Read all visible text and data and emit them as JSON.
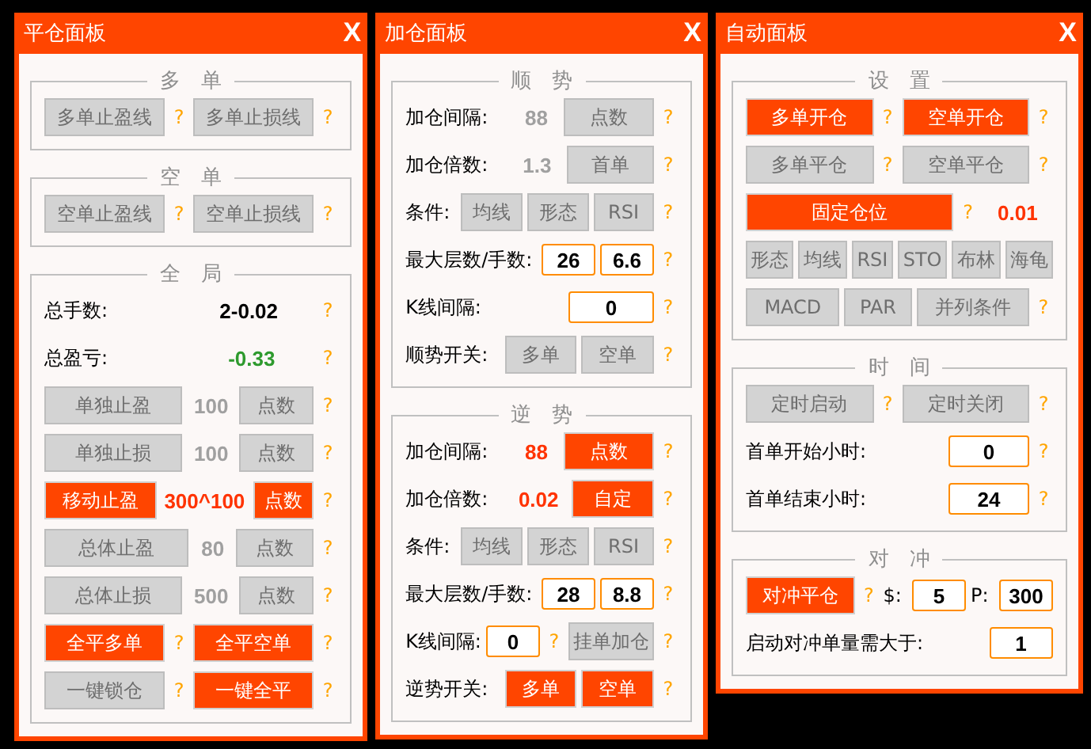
{
  "panels": [
    {
      "title": "平仓面板",
      "close": "X",
      "groups": [
        {
          "legend": "多　单",
          "rows": [
            {
              "items": [
                {
                  "kind": "button",
                  "label": "多单止盈线",
                  "on": false
                },
                {
                  "kind": "help",
                  "text": "?"
                },
                {
                  "kind": "button",
                  "label": "多单止损线",
                  "on": false
                },
                {
                  "kind": "help",
                  "text": "?"
                }
              ]
            }
          ]
        },
        {
          "legend": "空　单",
          "rows": [
            {
              "items": [
                {
                  "kind": "button",
                  "label": "空单止盈线",
                  "on": false
                },
                {
                  "kind": "help",
                  "text": "?"
                },
                {
                  "kind": "button",
                  "label": "空单止损线",
                  "on": false
                },
                {
                  "kind": "help",
                  "text": "?"
                }
              ]
            }
          ]
        },
        {
          "legend": "全　局",
          "rows": [
            {
              "items": [
                {
                  "kind": "label",
                  "text": "总手数:"
                },
                {
                  "kind": "value",
                  "text": "2-0.02",
                  "color": "#000000"
                },
                {
                  "kind": "help",
                  "text": "?"
                }
              ]
            },
            {
              "items": [
                {
                  "kind": "label",
                  "text": "总盈亏:"
                },
                {
                  "kind": "value",
                  "text": "-0.33",
                  "color": "#2e9a2e"
                },
                {
                  "kind": "help",
                  "text": "?"
                }
              ]
            },
            {
              "items": [
                {
                  "kind": "button",
                  "label": "单独止盈",
                  "on": false
                },
                {
                  "kind": "value",
                  "text": "100",
                  "color": "#a0a0a0"
                },
                {
                  "kind": "button",
                  "label": "点数",
                  "on": false
                },
                {
                  "kind": "help",
                  "text": "?"
                }
              ]
            },
            {
              "items": [
                {
                  "kind": "button",
                  "label": "单独止损",
                  "on": false
                },
                {
                  "kind": "value",
                  "text": "100",
                  "color": "#a0a0a0"
                },
                {
                  "kind": "button",
                  "label": "点数",
                  "on": false
                },
                {
                  "kind": "help",
                  "text": "?"
                }
              ]
            },
            {
              "items": [
                {
                  "kind": "button",
                  "label": "移动止盈",
                  "on": true
                },
                {
                  "kind": "value",
                  "text": "300^100",
                  "color": "#ff3300"
                },
                {
                  "kind": "button",
                  "label": "点数",
                  "on": true
                },
                {
                  "kind": "help",
                  "text": "?"
                }
              ]
            },
            {
              "items": [
                {
                  "kind": "button",
                  "label": "总体止盈",
                  "on": false
                },
                {
                  "kind": "value",
                  "text": "80",
                  "color": "#a0a0a0"
                },
                {
                  "kind": "button",
                  "label": "点数",
                  "on": false
                },
                {
                  "kind": "help",
                  "text": "?"
                }
              ]
            },
            {
              "items": [
                {
                  "kind": "button",
                  "label": "总体止损",
                  "on": false
                },
                {
                  "kind": "value",
                  "text": "500",
                  "color": "#a0a0a0"
                },
                {
                  "kind": "button",
                  "label": "点数",
                  "on": false
                },
                {
                  "kind": "help",
                  "text": "?"
                }
              ]
            },
            {
              "items": [
                {
                  "kind": "button",
                  "label": "全平多单",
                  "on": true
                },
                {
                  "kind": "help",
                  "text": "?"
                },
                {
                  "kind": "button",
                  "label": "全平空单",
                  "on": true
                },
                {
                  "kind": "help",
                  "text": "?"
                }
              ]
            },
            {
              "items": [
                {
                  "kind": "button",
                  "label": "一键锁仓",
                  "on": false
                },
                {
                  "kind": "help",
                  "text": "?"
                },
                {
                  "kind": "button",
                  "label": "一键全平",
                  "on": true
                },
                {
                  "kind": "help",
                  "text": "?"
                }
              ]
            }
          ]
        }
      ]
    },
    {
      "title": "加仓面板",
      "close": "X",
      "groups": [
        {
          "legend": "顺　势",
          "rows": [
            {
              "items": [
                {
                  "kind": "label",
                  "text": "加仓间隔:"
                },
                {
                  "kind": "value",
                  "text": "88",
                  "color": "#a0a0a0"
                },
                {
                  "kind": "button",
                  "label": "点数",
                  "on": false
                },
                {
                  "kind": "help",
                  "text": "?"
                }
              ]
            },
            {
              "items": [
                {
                  "kind": "label",
                  "text": "加仓倍数:"
                },
                {
                  "kind": "value",
                  "text": "1.3",
                  "color": "#a0a0a0"
                },
                {
                  "kind": "button",
                  "label": "首单",
                  "on": false
                },
                {
                  "kind": "help",
                  "text": "?"
                }
              ]
            },
            {
              "items": [
                {
                  "kind": "label",
                  "text": "条件:"
                },
                {
                  "kind": "button",
                  "label": "均线",
                  "on": false
                },
                {
                  "kind": "button",
                  "label": "形态",
                  "on": false
                },
                {
                  "kind": "button",
                  "label": "RSI",
                  "on": false
                },
                {
                  "kind": "help",
                  "text": "?"
                }
              ]
            },
            {
              "items": [
                {
                  "kind": "label",
                  "text": "最大层数/手数:"
                },
                {
                  "kind": "input",
                  "value": "26"
                },
                {
                  "kind": "input",
                  "value": "6.6"
                },
                {
                  "kind": "help",
                  "text": "?"
                }
              ]
            },
            {
              "items": [
                {
                  "kind": "label",
                  "text": "K线间隔:"
                },
                {
                  "kind": "input",
                  "value": "0"
                },
                {
                  "kind": "help",
                  "text": "?"
                }
              ]
            },
            {
              "items": [
                {
                  "kind": "label",
                  "text": "顺势开关:"
                },
                {
                  "kind": "button",
                  "label": "多单",
                  "on": false
                },
                {
                  "kind": "button",
                  "label": "空单",
                  "on": false
                },
                {
                  "kind": "help",
                  "text": "?"
                }
              ]
            }
          ]
        },
        {
          "legend": "逆　势",
          "rows": [
            {
              "items": [
                {
                  "kind": "label",
                  "text": "加仓间隔:"
                },
                {
                  "kind": "value",
                  "text": "88",
                  "color": "#ff3300"
                },
                {
                  "kind": "button",
                  "label": "点数",
                  "on": true
                },
                {
                  "kind": "help",
                  "text": "?"
                }
              ]
            },
            {
              "items": [
                {
                  "kind": "label",
                  "text": "加仓倍数:"
                },
                {
                  "kind": "value",
                  "text": "0.02",
                  "color": "#ff3300"
                },
                {
                  "kind": "button",
                  "label": "自定",
                  "on": true
                },
                {
                  "kind": "help",
                  "text": "?"
                }
              ]
            },
            {
              "items": [
                {
                  "kind": "label",
                  "text": "条件:"
                },
                {
                  "kind": "button",
                  "label": "均线",
                  "on": false
                },
                {
                  "kind": "button",
                  "label": "形态",
                  "on": false
                },
                {
                  "kind": "button",
                  "label": "RSI",
                  "on": false
                },
                {
                  "kind": "help",
                  "text": "?"
                }
              ]
            },
            {
              "items": [
                {
                  "kind": "label",
                  "text": "最大层数/手数:"
                },
                {
                  "kind": "input",
                  "value": "28"
                },
                {
                  "kind": "input",
                  "value": "8.8"
                },
                {
                  "kind": "help",
                  "text": "?"
                }
              ]
            },
            {
              "items": [
                {
                  "kind": "label",
                  "text": "K线间隔:"
                },
                {
                  "kind": "input",
                  "value": "0"
                },
                {
                  "kind": "help",
                  "text": "?"
                },
                {
                  "kind": "button",
                  "label": "挂单加仓",
                  "on": false
                },
                {
                  "kind": "help",
                  "text": "?"
                }
              ]
            },
            {
              "items": [
                {
                  "kind": "label",
                  "text": "逆势开关:"
                },
                {
                  "kind": "button",
                  "label": "多单",
                  "on": true
                },
                {
                  "kind": "button",
                  "label": "空单",
                  "on": true
                },
                {
                  "kind": "help",
                  "text": "?"
                }
              ]
            }
          ]
        }
      ]
    },
    {
      "title": "自动面板",
      "close": "X",
      "groups": [
        {
          "legend": "设　置",
          "rows": [
            {
              "items": [
                {
                  "kind": "button",
                  "label": "多单开仓",
                  "on": true
                },
                {
                  "kind": "help",
                  "text": "?"
                },
                {
                  "kind": "button",
                  "label": "空单开仓",
                  "on": true
                },
                {
                  "kind": "help",
                  "text": "?"
                }
              ]
            },
            {
              "items": [
                {
                  "kind": "button",
                  "label": "多单平仓",
                  "on": false
                },
                {
                  "kind": "help",
                  "text": "?"
                },
                {
                  "kind": "button",
                  "label": "空单平仓",
                  "on": false
                },
                {
                  "kind": "help",
                  "text": "?"
                }
              ]
            },
            {
              "items": [
                {
                  "kind": "button",
                  "label": "固定仓位",
                  "on": true
                },
                {
                  "kind": "help",
                  "text": "?"
                },
                {
                  "kind": "value",
                  "text": "0.01",
                  "color": "#ff3300"
                }
              ]
            },
            {
              "items": [
                {
                  "kind": "button",
                  "label": "形态",
                  "on": false
                },
                {
                  "kind": "button",
                  "label": "均线",
                  "on": false
                },
                {
                  "kind": "button",
                  "label": "RSI",
                  "on": false
                },
                {
                  "kind": "button",
                  "label": "STO",
                  "on": false
                },
                {
                  "kind": "button",
                  "label": "布林",
                  "on": false
                },
                {
                  "kind": "button",
                  "label": "海龟",
                  "on": false
                }
              ]
            },
            {
              "items": [
                {
                  "kind": "button",
                  "label": "MACD",
                  "on": false
                },
                {
                  "kind": "button",
                  "label": "PAR",
                  "on": false
                },
                {
                  "kind": "button",
                  "label": "并列条件",
                  "on": false
                },
                {
                  "kind": "help",
                  "text": "?"
                }
              ]
            }
          ]
        },
        {
          "legend": "时　间",
          "rows": [
            {
              "items": [
                {
                  "kind": "button",
                  "label": "定时启动",
                  "on": false
                },
                {
                  "kind": "help",
                  "text": "?"
                },
                {
                  "kind": "button",
                  "label": "定时关闭",
                  "on": false
                },
                {
                  "kind": "help",
                  "text": "?"
                }
              ]
            },
            {
              "items": [
                {
                  "kind": "label",
                  "text": "首单开始小时:"
                },
                {
                  "kind": "input",
                  "value": "0"
                },
                {
                  "kind": "help",
                  "text": "?"
                }
              ]
            },
            {
              "items": [
                {
                  "kind": "label",
                  "text": "首单结束小时:"
                },
                {
                  "kind": "input",
                  "value": "24"
                },
                {
                  "kind": "help",
                  "text": "?"
                }
              ]
            }
          ]
        },
        {
          "legend": "对　冲",
          "rows": [
            {
              "items": [
                {
                  "kind": "button",
                  "label": "对冲平仓",
                  "on": true
                },
                {
                  "kind": "help",
                  "text": "?"
                },
                {
                  "kind": "label",
                  "text": "$:"
                },
                {
                  "kind": "input",
                  "value": "5"
                },
                {
                  "kind": "label",
                  "text": "P:"
                },
                {
                  "kind": "input",
                  "value": "300"
                }
              ]
            },
            {
              "items": [
                {
                  "kind": "label",
                  "text": "启动对冲单量需大于:"
                },
                {
                  "kind": "input",
                  "value": "1"
                }
              ]
            }
          ]
        }
      ]
    }
  ]
}
